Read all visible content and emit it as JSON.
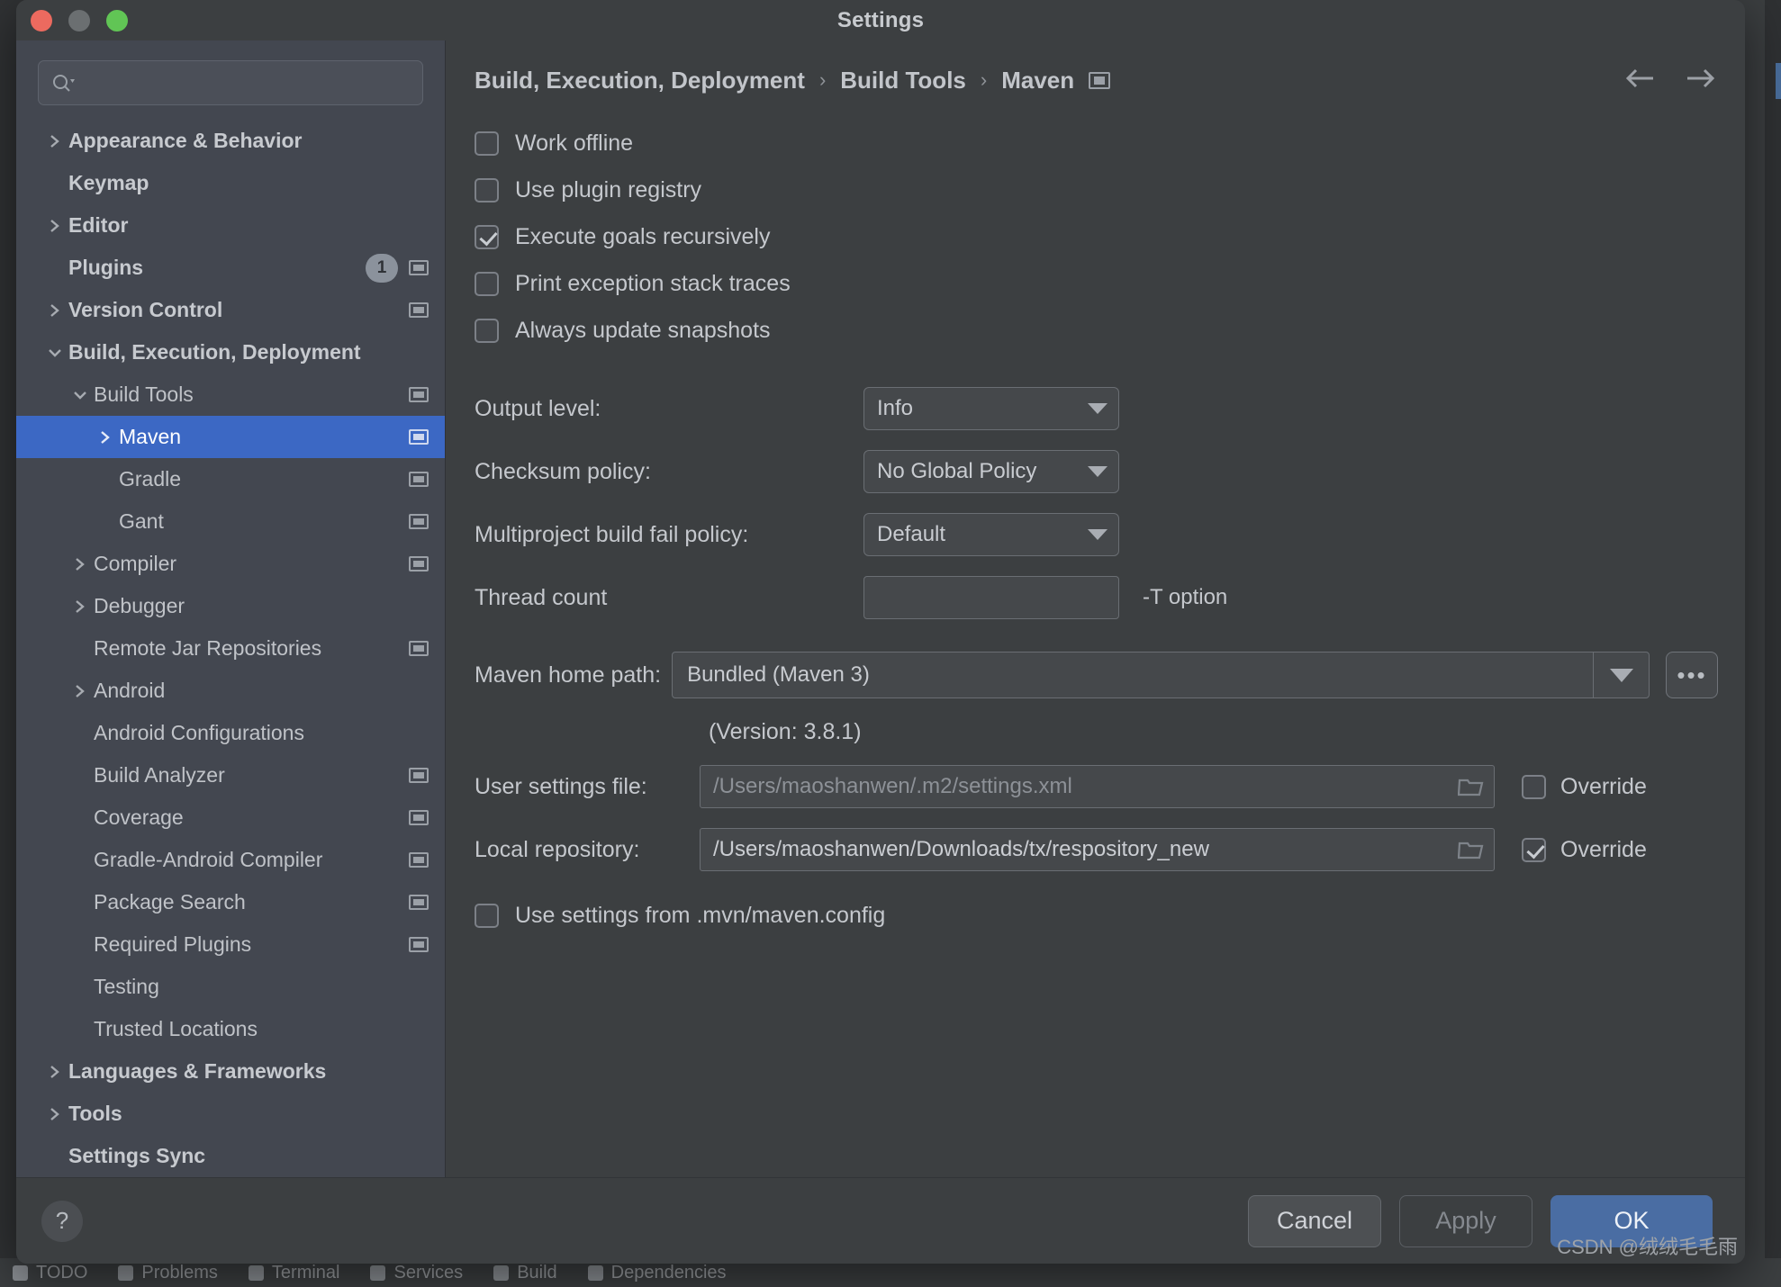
{
  "window": {
    "title": "Settings",
    "traffic_lights": [
      "close",
      "minimize",
      "maximize"
    ]
  },
  "search": {
    "value": "",
    "placeholder": ""
  },
  "sidebar": {
    "items": [
      {
        "label": "Appearance & Behavior",
        "indent": 0,
        "twisty": "right",
        "bold": true,
        "project_icon": false,
        "badge": null,
        "selected": false
      },
      {
        "label": "Keymap",
        "indent": 0,
        "twisty": "none",
        "bold": true,
        "project_icon": false,
        "badge": null,
        "selected": false
      },
      {
        "label": "Editor",
        "indent": 0,
        "twisty": "right",
        "bold": true,
        "project_icon": false,
        "badge": null,
        "selected": false
      },
      {
        "label": "Plugins",
        "indent": 0,
        "twisty": "none",
        "bold": true,
        "project_icon": true,
        "badge": "1",
        "selected": false
      },
      {
        "label": "Version Control",
        "indent": 0,
        "twisty": "right",
        "bold": true,
        "project_icon": true,
        "badge": null,
        "selected": false
      },
      {
        "label": "Build, Execution, Deployment",
        "indent": 0,
        "twisty": "down",
        "bold": true,
        "project_icon": false,
        "badge": null,
        "selected": false
      },
      {
        "label": "Build Tools",
        "indent": 1,
        "twisty": "down",
        "bold": false,
        "project_icon": true,
        "badge": null,
        "selected": false
      },
      {
        "label": "Maven",
        "indent": 2,
        "twisty": "right",
        "bold": false,
        "project_icon": true,
        "badge": null,
        "selected": true
      },
      {
        "label": "Gradle",
        "indent": 2,
        "twisty": "none",
        "bold": false,
        "project_icon": true,
        "badge": null,
        "selected": false
      },
      {
        "label": "Gant",
        "indent": 2,
        "twisty": "none",
        "bold": false,
        "project_icon": true,
        "badge": null,
        "selected": false
      },
      {
        "label": "Compiler",
        "indent": 1,
        "twisty": "right",
        "bold": false,
        "project_icon": true,
        "badge": null,
        "selected": false
      },
      {
        "label": "Debugger",
        "indent": 1,
        "twisty": "right",
        "bold": false,
        "project_icon": false,
        "badge": null,
        "selected": false
      },
      {
        "label": "Remote Jar Repositories",
        "indent": 1,
        "twisty": "none",
        "bold": false,
        "project_icon": true,
        "badge": null,
        "selected": false
      },
      {
        "label": "Android",
        "indent": 1,
        "twisty": "right",
        "bold": false,
        "project_icon": false,
        "badge": null,
        "selected": false
      },
      {
        "label": "Android Configurations",
        "indent": 1,
        "twisty": "none",
        "bold": false,
        "project_icon": false,
        "badge": null,
        "selected": false
      },
      {
        "label": "Build Analyzer",
        "indent": 1,
        "twisty": "none",
        "bold": false,
        "project_icon": true,
        "badge": null,
        "selected": false
      },
      {
        "label": "Coverage",
        "indent": 1,
        "twisty": "none",
        "bold": false,
        "project_icon": true,
        "badge": null,
        "selected": false
      },
      {
        "label": "Gradle-Android Compiler",
        "indent": 1,
        "twisty": "none",
        "bold": false,
        "project_icon": true,
        "badge": null,
        "selected": false
      },
      {
        "label": "Package Search",
        "indent": 1,
        "twisty": "none",
        "bold": false,
        "project_icon": true,
        "badge": null,
        "selected": false
      },
      {
        "label": "Required Plugins",
        "indent": 1,
        "twisty": "none",
        "bold": false,
        "project_icon": true,
        "badge": null,
        "selected": false
      },
      {
        "label": "Testing",
        "indent": 1,
        "twisty": "none",
        "bold": false,
        "project_icon": false,
        "badge": null,
        "selected": false
      },
      {
        "label": "Trusted Locations",
        "indent": 1,
        "twisty": "none",
        "bold": false,
        "project_icon": false,
        "badge": null,
        "selected": false
      },
      {
        "label": "Languages & Frameworks",
        "indent": 0,
        "twisty": "right",
        "bold": true,
        "project_icon": false,
        "badge": null,
        "selected": false
      },
      {
        "label": "Tools",
        "indent": 0,
        "twisty": "right",
        "bold": true,
        "project_icon": false,
        "badge": null,
        "selected": false
      },
      {
        "label": "Settings Sync",
        "indent": 0,
        "twisty": "none",
        "bold": true,
        "project_icon": false,
        "badge": null,
        "selected": false
      }
    ]
  },
  "breadcrumb": {
    "parts": [
      "Build, Execution, Deployment",
      "Build Tools",
      "Maven"
    ],
    "separator": "›",
    "project_icon": "project-scope-icon",
    "back_icon": "arrow-left-icon",
    "forward_icon": "arrow-right-icon"
  },
  "main": {
    "checkboxes": [
      {
        "label": "Work offline",
        "checked": false
      },
      {
        "label": "Use plugin registry",
        "checked": false
      },
      {
        "label": "Execute goals recursively",
        "checked": true
      },
      {
        "label": "Print exception stack traces",
        "checked": false
      },
      {
        "label": "Always update snapshots",
        "checked": false
      }
    ],
    "output_level": {
      "label": "Output level:",
      "value": "Info"
    },
    "checksum_policy": {
      "label": "Checksum policy:",
      "value": "No Global Policy"
    },
    "multiproject_policy": {
      "label": "Multiproject build fail policy:",
      "value": "Default"
    },
    "thread_count": {
      "label": "Thread count",
      "value": "",
      "hint": "-T option"
    },
    "maven_home": {
      "label": "Maven home path:",
      "value": "Bundled (Maven 3)",
      "browse_label": "•••",
      "version_text": "(Version: 3.8.1)"
    },
    "user_settings": {
      "label": "User settings file:",
      "value": "/Users/maoshanwen/.m2/settings.xml",
      "is_placeholder": true,
      "override_label": "Override",
      "override_checked": false
    },
    "local_repository": {
      "label": "Local repository:",
      "value": "/Users/maoshanwen/Downloads/tx/respository_new",
      "is_placeholder": false,
      "override_label": "Override",
      "override_checked": true
    },
    "mvn_config": {
      "label": "Use settings from .mvn/maven.config",
      "checked": false
    }
  },
  "footer": {
    "help_label": "?",
    "cancel_label": "Cancel",
    "apply_label": "Apply",
    "ok_label": "OK",
    "watermark": "CSDN @绒绒毛毛雨"
  },
  "ide_statusbar": {
    "items": [
      "TODO",
      "Problems",
      "Terminal",
      "Services",
      "Build",
      "Dependencies"
    ]
  },
  "colors": {
    "accent": "#3c68c4",
    "ok_button": "#4a6da3",
    "dialog_bg": "#3c3f41",
    "sidebar_bg": "#434750",
    "text": "#c5c8cd"
  }
}
